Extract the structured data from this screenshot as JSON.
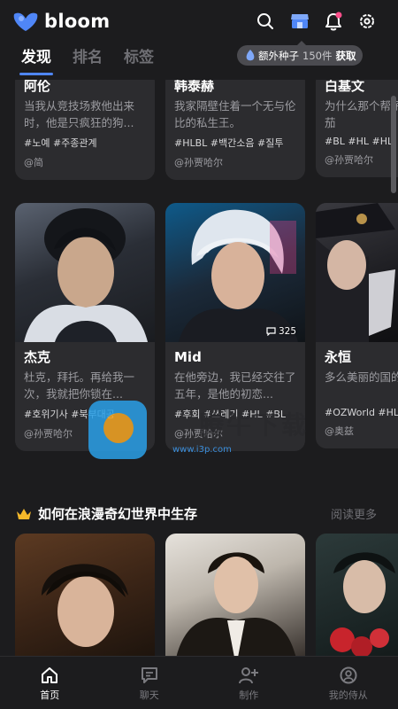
{
  "app": {
    "name": "bloom"
  },
  "header": {
    "tabs": [
      {
        "label": "发现",
        "active": true
      },
      {
        "label": "排名",
        "active": false
      },
      {
        "label": "标签",
        "active": false
      }
    ],
    "icons": [
      "search-icon",
      "store-icon",
      "bell-icon",
      "settings-icon"
    ],
    "seed_pill": {
      "label": "额外种子",
      "count": "150件",
      "action": "获取"
    }
  },
  "cards_top": [
    {
      "name": "阿伦",
      "desc": "当我从竞技场救他出来时，他是只疯狂的狗...",
      "tags": "#노예 #주종관계",
      "author": "@简"
    },
    {
      "name": "韩泰赫",
      "desc": "我家隔壁住着一个无与伦比的私生王。",
      "tags": "#HLBL #백간소음 #질투",
      "author": "@孙贾哈尔"
    },
    {
      "name": "白基文",
      "desc": "为什么那个帮子的小欧米茄",
      "tags": "#BL #HL #HL",
      "author": "@孙贾哈尔"
    }
  ],
  "cards_mid": [
    {
      "name": "杰克",
      "desc": "杜克，拜托。再给我一次，我就把你锁在...",
      "tags": "#호위기사 #북부대공",
      "author": "@孙贾哈尔",
      "badge": ""
    },
    {
      "name": "Mid",
      "desc": "在他旁边，我已经交往了五年，是他的初恋...",
      "tags": "#후회 #쓰레기 #HL #BL",
      "author": "@孙贾哈尔",
      "badge": "325"
    },
    {
      "name": "永恒",
      "desc": "多么美丽的国的地......",
      "tags": "#OZWorld #HL",
      "author": "@奥兹",
      "badge": ""
    }
  ],
  "section": {
    "title": "如何在浪漫奇幻世界中生存",
    "read_more": "阅读更多",
    "icon": "crown-icon"
  },
  "bottom_nav": [
    {
      "label": "首页",
      "icon": "home-icon",
      "active": true
    },
    {
      "label": "聊天",
      "icon": "chat-icon",
      "active": false
    },
    {
      "label": "制作",
      "icon": "create-icon",
      "active": false
    },
    {
      "label": "我的侍从",
      "icon": "profile-icon",
      "active": false
    }
  ],
  "watermark": {
    "text": "腾牛下载",
    "url": "www.i3p.com"
  },
  "colors": {
    "background": "#1c1c1e",
    "card": "#2c2c2f",
    "accent": "#4f86f7"
  }
}
